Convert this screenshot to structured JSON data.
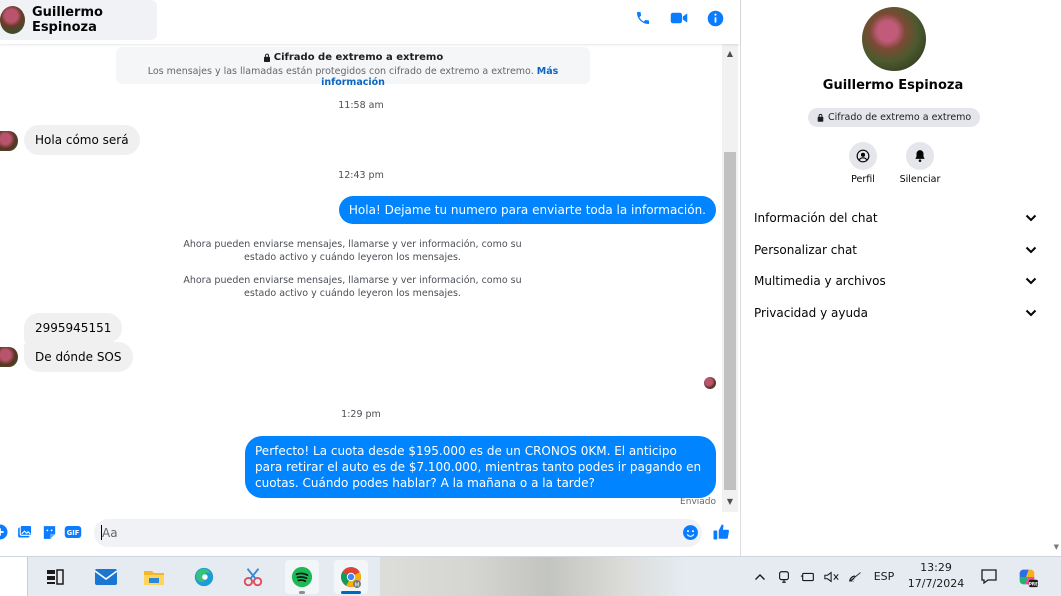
{
  "header": {
    "contact_name": "Guillermo Espinoza"
  },
  "encryption_banner": {
    "title": "Cifrado de extremo a extremo",
    "body": "Los mensajes y las llamadas están protegidos con cifrado de extremo a extremo.",
    "link": "Más información"
  },
  "messages": [
    {
      "type": "timestamp",
      "text": "11:58 am"
    },
    {
      "type": "incoming",
      "text": "Hola cómo será"
    },
    {
      "type": "timestamp",
      "text": "12:43 pm"
    },
    {
      "type": "outgoing",
      "text": "Hola! Dejame tu numero  para enviarte toda la información."
    },
    {
      "type": "system",
      "text": "Ahora pueden enviarse mensajes, llamarse y ver información, como su estado activo y cuándo leyeron los mensajes."
    },
    {
      "type": "system",
      "text": "Ahora pueden enviarse mensajes, llamarse y ver información, como su estado activo y cuándo leyeron los mensajes."
    },
    {
      "type": "incoming",
      "text": "2995945151"
    },
    {
      "type": "incoming",
      "text": "De dónde SOS"
    },
    {
      "type": "timestamp",
      "text": "1:29 pm"
    },
    {
      "type": "outgoing",
      "text": "Perfecto! La cuota desde $195.000 es de un CRONOS 0KM. El anticipo para retirar el auto es de $7.100.000, mientras tanto podes ir pagando en cuotas. Cuándo podes hablar? A la mañana o a la tarde?"
    }
  ],
  "delivery_status": "Enviado",
  "composer": {
    "placeholder": "Aa"
  },
  "info_panel": {
    "name": "Guillermo Espinoza",
    "badge": "Cifrado de extremo a extremo",
    "actions": [
      {
        "label": "Perfil",
        "icon": "profile-icon"
      },
      {
        "label": "Silenciar",
        "icon": "bell-icon"
      }
    ],
    "sections": [
      {
        "label": "Información del chat"
      },
      {
        "label": "Personalizar chat"
      },
      {
        "label": "Multimedia y archivos"
      },
      {
        "label": "Privacidad y ayuda"
      }
    ]
  },
  "taskbar": {
    "apps": [
      "task-view",
      "mail",
      "file-explorer",
      "edge",
      "snipping-tool",
      "spotify",
      "chrome"
    ],
    "language": "ESP",
    "time": "13:29",
    "date": "17/7/2024"
  },
  "colors": {
    "accent": "#0084ff",
    "icon_blue": "#0a7cff",
    "incoming_bubble": "#f0f0f0"
  }
}
